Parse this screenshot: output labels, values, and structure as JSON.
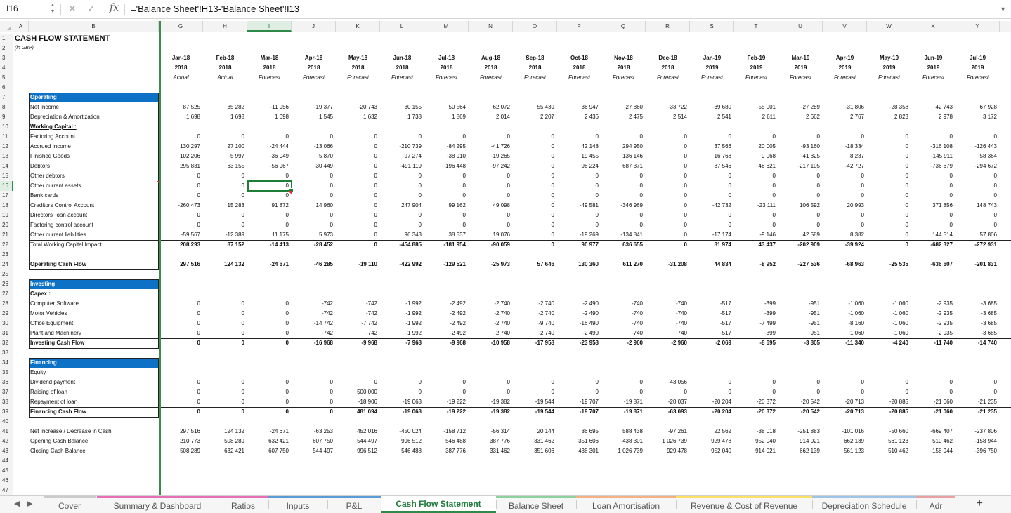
{
  "formula_bar": {
    "name_box": "I16",
    "formula": "='Balance Sheet'!H13-'Balance Sheet'!I13",
    "fx_label": "fx"
  },
  "columns": [
    "A",
    "B",
    "G",
    "H",
    "I",
    "J",
    "K",
    "L",
    "M",
    "N",
    "O",
    "P",
    "Q",
    "R",
    "S",
    "T",
    "U",
    "V",
    "W",
    "X",
    "Y"
  ],
  "selected_column": "I",
  "selected_row": 16,
  "rows": [
    {
      "n": 1,
      "label": "CASH FLOW STATEMENT",
      "style": "title"
    },
    {
      "n": 2,
      "label": "(in GBP)",
      "style": "sub"
    },
    {
      "n": 3,
      "label": "",
      "values": [
        "Jan-18",
        "Feb-18",
        "Mar-18",
        "Apr-18",
        "May-18",
        "Jun-18",
        "Jul-18",
        "Aug-18",
        "Sep-18",
        "Oct-18",
        "Nov-18",
        "Dec-18",
        "Jan-19",
        "Feb-19",
        "Mar-19",
        "Apr-19",
        "May-19",
        "Jun-19",
        "Jul-19"
      ],
      "vstyle": "h"
    },
    {
      "n": 4,
      "label": "",
      "values": [
        "2018",
        "2018",
        "2018",
        "2018",
        "2018",
        "2018",
        "2018",
        "2018",
        "2018",
        "2018",
        "2018",
        "2018",
        "2019",
        "2019",
        "2019",
        "2019",
        "2019",
        "2019",
        "2019"
      ],
      "vstyle": "h"
    },
    {
      "n": 5,
      "label": "",
      "values": [
        "Actual",
        "Actual",
        "Forecast",
        "Forecast",
        "Forecast",
        "Forecast",
        "Forecast",
        "Forecast",
        "Forecast",
        "Forecast",
        "Forecast",
        "Forecast",
        "Forecast",
        "Forecast",
        "Forecast",
        "Forecast",
        "Forecast",
        "Forecast",
        "Forecast"
      ],
      "vstyle": "hi"
    },
    {
      "n": 6,
      "label": ""
    },
    {
      "n": 7,
      "label": "Operating",
      "style": "sec"
    },
    {
      "n": 8,
      "label": "Net Income",
      "values": [
        "87 525",
        "35 282",
        "-11 956",
        "-19 377",
        "-20 743",
        "30 155",
        "50 564",
        "62 072",
        "55 439",
        "36 947",
        "-27 860",
        "-33 722",
        "-39 680",
        "-55 001",
        "-27 289",
        "-31 806",
        "-28 358",
        "42 743",
        "67 928"
      ]
    },
    {
      "n": 9,
      "label": "Depreciation & Amortization",
      "values": [
        "1 698",
        "1 698",
        "1 698",
        "1 545",
        "1 632",
        "1 738",
        "1 869",
        "2 014",
        "2 207",
        "2 436",
        "2 475",
        "2 514",
        "2 541",
        "2 611",
        "2 662",
        "2 767",
        "2 823",
        "2 978",
        "3 172"
      ]
    },
    {
      "n": 10,
      "label": "Working Capital :",
      "style": "u"
    },
    {
      "n": 11,
      "label": "Factoring Account",
      "values": [
        "0",
        "0",
        "0",
        "0",
        "0",
        "0",
        "0",
        "0",
        "0",
        "0",
        "0",
        "0",
        "0",
        "0",
        "0",
        "0",
        "0",
        "0",
        "0"
      ]
    },
    {
      "n": 12,
      "label": "Accrued Income",
      "values": [
        "130 297",
        "27 100",
        "-24 444",
        "-13 066",
        "0",
        "-210 739",
        "-84 295",
        "-41 726",
        "0",
        "42 148",
        "294 950",
        "0",
        "37 566",
        "20 005",
        "-93 160",
        "-18 334",
        "0",
        "-316 108",
        "-126 443"
      ]
    },
    {
      "n": 13,
      "label": "Finished Goods",
      "values": [
        "102 206",
        "-5 997",
        "-36 049",
        "-5 870",
        "0",
        "-97 274",
        "-38 910",
        "-19 265",
        "0",
        "19 455",
        "136 146",
        "0",
        "16 768",
        "9 068",
        "-41 825",
        "-8 237",
        "0",
        "-145 911",
        "-58 364"
      ]
    },
    {
      "n": 14,
      "label": "Debtors",
      "values": [
        "295 831",
        "63 155",
        "-56 967",
        "-30 449",
        "0",
        "-491 119",
        "-196 448",
        "-97 242",
        "0",
        "98 224",
        "687 371",
        "0",
        "87 546",
        "46 621",
        "-217 105",
        "-42 727",
        "0",
        "-736 679",
        "-294 672"
      ]
    },
    {
      "n": 15,
      "label": "Other debtors",
      "values": [
        "0",
        "0",
        "0",
        "0",
        "0",
        "0",
        "0",
        "0",
        "0",
        "0",
        "0",
        "0",
        "0",
        "0",
        "0",
        "0",
        "0",
        "0",
        "0"
      ]
    },
    {
      "n": 16,
      "label": "Other current assets",
      "values": [
        "0",
        "0",
        "0",
        "0",
        "0",
        "0",
        "0",
        "0",
        "0",
        "0",
        "0",
        "0",
        "0",
        "0",
        "0",
        "0",
        "0",
        "0",
        "0"
      ]
    },
    {
      "n": 17,
      "label": "Bank cards",
      "values": [
        "0",
        "0",
        "0",
        "0",
        "0",
        "0",
        "0",
        "0",
        "0",
        "0",
        "0",
        "0",
        "0",
        "0",
        "0",
        "0",
        "0",
        "0",
        "0"
      ]
    },
    {
      "n": 18,
      "label": "Creditors Control Account",
      "values": [
        "-260 473",
        "15 283",
        "91 872",
        "14 960",
        "0",
        "247 904",
        "99 162",
        "49 098",
        "0",
        "-49 581",
        "-346 969",
        "0",
        "-42 732",
        "-23 111",
        "106 592",
        "20 993",
        "0",
        "371 856",
        "148 743"
      ]
    },
    {
      "n": 19,
      "label": "Directors' loan account",
      "values": [
        "0",
        "0",
        "0",
        "0",
        "0",
        "0",
        "0",
        "0",
        "0",
        "0",
        "0",
        "0",
        "0",
        "0",
        "0",
        "0",
        "0",
        "0",
        "0"
      ]
    },
    {
      "n": 20,
      "label": "Factoring control account",
      "values": [
        "0",
        "0",
        "0",
        "0",
        "0",
        "0",
        "0",
        "0",
        "0",
        "0",
        "0",
        "0",
        "0",
        "0",
        "0",
        "0",
        "0",
        "0",
        "0"
      ]
    },
    {
      "n": 21,
      "label": "Other current liabilities",
      "values": [
        "-59 567",
        "-12 389",
        "11 175",
        "5 973",
        "0",
        "96 343",
        "38 537",
        "19 076",
        "0",
        "-19 269",
        "-134 841",
        "0",
        "-17 174",
        "-9 146",
        "42 589",
        "8 382",
        "0",
        "144 514",
        "57 806"
      ]
    },
    {
      "n": 22,
      "label": "Total Working Capital Impact",
      "values": [
        "208 293",
        "87 152",
        "-14 413",
        "-28 452",
        "0",
        "-454 885",
        "-181 954",
        "-90 059",
        "0",
        "90 977",
        "636 655",
        "0",
        "81 974",
        "43 437",
        "-202 909",
        "-39 924",
        "0",
        "-682 327",
        "-272 931"
      ],
      "vstyle": "bold"
    },
    {
      "n": 23,
      "label": ""
    },
    {
      "n": 24,
      "label": "Operating Cash Flow",
      "style": "bold",
      "values": [
        "297 516",
        "124 132",
        "-24 671",
        "-46 285",
        "-19 110",
        "-422 992",
        "-129 521",
        "-25 973",
        "57 646",
        "130 360",
        "611 270",
        "-31 208",
        "44 834",
        "-8 952",
        "-227 536",
        "-68 963",
        "-25 535",
        "-636 607",
        "-201 831"
      ],
      "vstyle": "bold"
    },
    {
      "n": 25,
      "label": ""
    },
    {
      "n": 26,
      "label": "Investing",
      "style": "sec"
    },
    {
      "n": 27,
      "label": "Capex :",
      "style": "bold"
    },
    {
      "n": 28,
      "label": "Computer Software",
      "values": [
        "0",
        "0",
        "0",
        "-742",
        "-742",
        "-1 992",
        "-2 492",
        "-2 740",
        "-2 740",
        "-2 490",
        "-740",
        "-740",
        "-517",
        "-399",
        "-951",
        "-1 060",
        "-1 060",
        "-2 935",
        "-3 685"
      ]
    },
    {
      "n": 29,
      "label": "Motor Vehicles",
      "values": [
        "0",
        "0",
        "0",
        "-742",
        "-742",
        "-1 992",
        "-2 492",
        "-2 740",
        "-2 740",
        "-2 490",
        "-740",
        "-740",
        "-517",
        "-399",
        "-951",
        "-1 060",
        "-1 060",
        "-2 935",
        "-3 685"
      ]
    },
    {
      "n": 30,
      "label": "Office Equipment",
      "values": [
        "0",
        "0",
        "0",
        "-14 742",
        "-7 742",
        "-1 992",
        "-2 492",
        "-2 740",
        "-9 740",
        "-16 490",
        "-740",
        "-740",
        "-517",
        "-7 499",
        "-951",
        "-8 160",
        "-1 060",
        "-2 935",
        "-3 685"
      ]
    },
    {
      "n": 31,
      "label": "Plant and Machinery",
      "values": [
        "0",
        "0",
        "0",
        "-742",
        "-742",
        "-1 992",
        "-2 492",
        "-2 740",
        "-2 740",
        "-2 490",
        "-740",
        "-740",
        "-517",
        "-399",
        "-951",
        "-1 060",
        "-1 060",
        "-2 935",
        "-3 685"
      ]
    },
    {
      "n": 32,
      "label": "Investing Cash Flow",
      "style": "bold",
      "values": [
        "0",
        "0",
        "0",
        "-16 968",
        "-9 968",
        "-7 968",
        "-9 968",
        "-10 958",
        "-17 958",
        "-23 958",
        "-2 960",
        "-2 960",
        "-2 069",
        "-8 695",
        "-3 805",
        "-11 340",
        "-4 240",
        "-11 740",
        "-14 740"
      ],
      "vstyle": "bold"
    },
    {
      "n": 33,
      "label": ""
    },
    {
      "n": 34,
      "label": "Financing",
      "style": "sec"
    },
    {
      "n": 35,
      "label": "Equity"
    },
    {
      "n": 36,
      "label": "Dividend payment",
      "values": [
        "0",
        "0",
        "0",
        "0",
        "0",
        "0",
        "0",
        "0",
        "0",
        "0",
        "0",
        "-43 056",
        "0",
        "0",
        "0",
        "0",
        "0",
        "0",
        "0"
      ]
    },
    {
      "n": 37,
      "label": "Raising of loan",
      "values": [
        "0",
        "0",
        "0",
        "0",
        "500 000",
        "0",
        "0",
        "0",
        "0",
        "0",
        "0",
        "0",
        "0",
        "0",
        "0",
        "0",
        "0",
        "0",
        "0"
      ]
    },
    {
      "n": 38,
      "label": "Repayment of loan",
      "values": [
        "0",
        "0",
        "0",
        "0",
        "-18 906",
        "-19 063",
        "-19 222",
        "-19 382",
        "-19 544",
        "-19 707",
        "-19 871",
        "-20 037",
        "-20 204",
        "-20 372",
        "-20 542",
        "-20 713",
        "-20 885",
        "-21 060",
        "-21 235"
      ]
    },
    {
      "n": 39,
      "label": "Financing Cash Flow",
      "style": "bold",
      "values": [
        "0",
        "0",
        "0",
        "0",
        "481 094",
        "-19 063",
        "-19 222",
        "-19 382",
        "-19 544",
        "-19 707",
        "-19 871",
        "-63 093",
        "-20 204",
        "-20 372",
        "-20 542",
        "-20 713",
        "-20 885",
        "-21 060",
        "-21 235"
      ],
      "vstyle": "bold"
    },
    {
      "n": 40,
      "label": ""
    },
    {
      "n": 41,
      "label": "Net Increase / Decrease in Cash",
      "values": [
        "297 516",
        "124 132",
        "-24 671",
        "-63 253",
        "452 016",
        "-450 024",
        "-158 712",
        "-56 314",
        "20 144",
        "86 695",
        "588 438",
        "-97 261",
        "22 562",
        "-38 018",
        "-251 883",
        "-101 016",
        "-50 660",
        "-669 407",
        "-237 806"
      ]
    },
    {
      "n": 42,
      "label": "Opening Cash Balance",
      "values": [
        "210 773",
        "508 289",
        "632 421",
        "607 750",
        "544 497",
        "996 512",
        "546 488",
        "387 776",
        "331 462",
        "351 606",
        "438 301",
        "1 026 739",
        "929 478",
        "952 040",
        "914 021",
        "662 139",
        "561 123",
        "510 462",
        "-158 944"
      ]
    },
    {
      "n": 43,
      "label": "Closing Cash Balance",
      "values": [
        "508 289",
        "632 421",
        "607 750",
        "544 497",
        "996 512",
        "546 488",
        "387 776",
        "331 462",
        "351 606",
        "438 301",
        "1 026 739",
        "929 478",
        "952 040",
        "914 021",
        "662 139",
        "561 123",
        "510 462",
        "-158 944",
        "-396 750"
      ]
    },
    {
      "n": 44,
      "label": ""
    },
    {
      "n": 45,
      "label": ""
    },
    {
      "n": 46,
      "label": ""
    },
    {
      "n": 47,
      "label": ""
    }
  ],
  "sheet_tabs": [
    {
      "name": "Cover",
      "color": "#cccccc"
    },
    {
      "name": "Summary & Dashboard",
      "color": "#e86fb5"
    },
    {
      "name": "Ratios",
      "color": "#e86fb5"
    },
    {
      "name": "Inputs",
      "color": "#5b9bd5"
    },
    {
      "name": "P&L",
      "color": "#5b9bd5"
    },
    {
      "name": "Cash Flow Statement",
      "color": "#2f8a4a",
      "active": true
    },
    {
      "name": "Balance Sheet",
      "color": "#8fd19e"
    },
    {
      "name": "Loan Amortisation",
      "color": "#f4b183"
    },
    {
      "name": "Revenue & Cost of Revenue",
      "color": "#ffe066"
    },
    {
      "name": "Depreciation Schedule",
      "color": "#9dc3e6"
    },
    {
      "name": "Adr",
      "color": "#e8a0a0"
    }
  ],
  "tab_nav": {
    "prev": "◀",
    "next": "▶",
    "add": "+"
  }
}
